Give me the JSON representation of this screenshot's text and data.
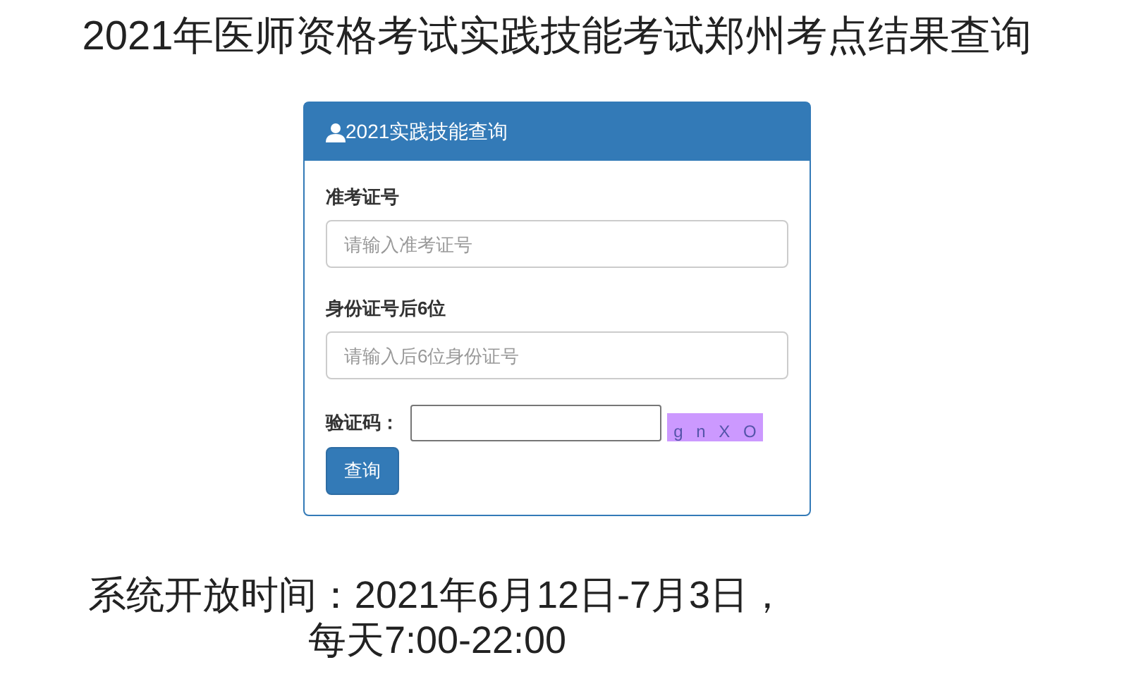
{
  "page_title": "2021年医师资格考试实践技能考试郑州考点结果查询",
  "panel": {
    "title": "2021实践技能查询",
    "fields": [
      {
        "label": "准考证号",
        "placeholder": "请输入准考证号"
      },
      {
        "label": "身份证号后6位",
        "placeholder": "请输入后6位身份证号"
      }
    ],
    "captcha": {
      "label": "验证码：",
      "characters": [
        "g",
        "n",
        "X",
        "O"
      ]
    },
    "submit": "查询"
  },
  "notice_lines": [
    "系统开放时间：2021年6月12日-7月3日，",
    "每天7:00-22:00"
  ]
}
